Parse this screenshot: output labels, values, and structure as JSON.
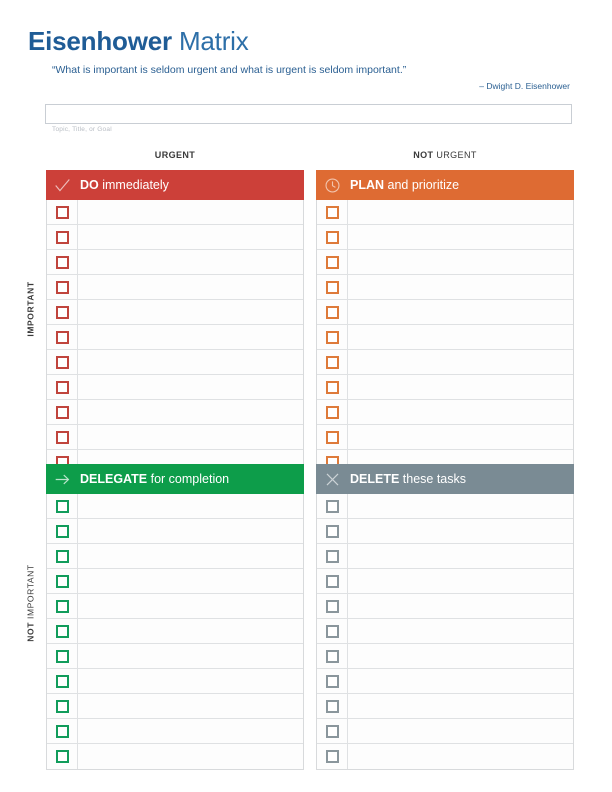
{
  "header": {
    "title_strong": "Eisenhower",
    "title_light": " Matrix",
    "quote": "“What is important is seldom urgent and what is urgent is seldom important.”",
    "attribution": "– Dwight D. Eisenhower",
    "topic_value": "",
    "topic_placeholder": "",
    "topic_caption": "Topic, Title, or Goal"
  },
  "axes": {
    "columns": [
      {
        "bold": "URGENT",
        "regular": ""
      },
      {
        "bold": "NOT",
        "regular": " URGENT"
      }
    ],
    "rows": [
      {
        "bold": "IMPORTANT",
        "regular": ""
      },
      {
        "bold": "NOT",
        "regular": " IMPORTANT"
      }
    ]
  },
  "quadrants": [
    {
      "key": "do",
      "icon": "check-icon",
      "title_bold": "DO",
      "title_regular": " immediately",
      "color": "#CC4039",
      "checkbox_color": "#C0443C",
      "row_count": 11,
      "tasks": [
        "",
        "",
        "",
        "",
        "",
        "",
        "",
        "",
        "",
        "",
        ""
      ]
    },
    {
      "key": "plan",
      "icon": "clock-icon",
      "title_bold": "PLAN",
      "title_regular": " and prioritize",
      "color": "#DE6B33",
      "checkbox_color": "#DE7A3A",
      "row_count": 11,
      "tasks": [
        "",
        "",
        "",
        "",
        "",
        "",
        "",
        "",
        "",
        "",
        ""
      ]
    },
    {
      "key": "delegate",
      "icon": "arrow-right-icon",
      "title_bold": "DELEGATE",
      "title_regular": " for completion",
      "color": "#0D9D4A",
      "checkbox_color": "#119C5B",
      "row_count": 11,
      "tasks": [
        "",
        "",
        "",
        "",
        "",
        "",
        "",
        "",
        "",
        "",
        ""
      ]
    },
    {
      "key": "delete",
      "icon": "close-x-icon",
      "title_bold": "DELETE",
      "title_regular": " these tasks",
      "color": "#7A8B94",
      "checkbox_color": "#8A969C",
      "row_count": 11,
      "tasks": [
        "",
        "",
        "",
        "",
        "",
        "",
        "",
        "",
        "",
        "",
        ""
      ]
    }
  ]
}
